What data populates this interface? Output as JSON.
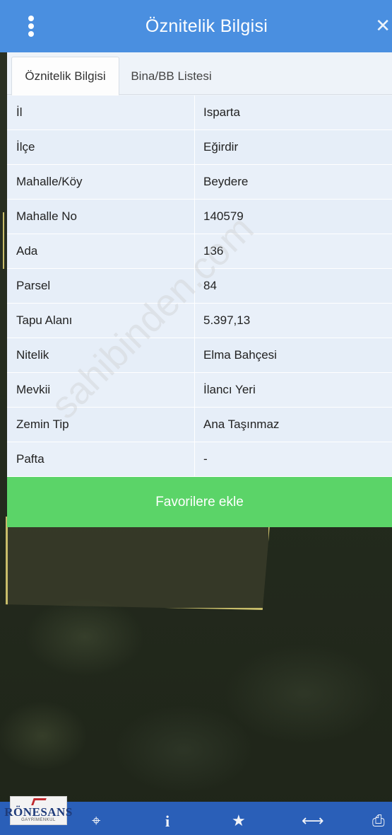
{
  "header": {
    "title": "Öznitelik Bilgisi",
    "menu_icon": "vertical-dots-icon",
    "close_label": "✕"
  },
  "tabs": [
    {
      "label": "Öznitelik Bilgisi",
      "active": true
    },
    {
      "label": "Bina/BB Listesi",
      "active": false
    }
  ],
  "attributes": [
    {
      "key": "İl",
      "value": "Isparta"
    },
    {
      "key": "İlçe",
      "value": "Eğirdir"
    },
    {
      "key": "Mahalle/Köy",
      "value": "Beydere"
    },
    {
      "key": "Mahalle No",
      "value": "140579"
    },
    {
      "key": "Ada",
      "value": "136"
    },
    {
      "key": "Parsel",
      "value": "84"
    },
    {
      "key": "Tapu Alanı",
      "value": "5.397,13"
    },
    {
      "key": "Nitelik",
      "value": "Elma Bahçesi"
    },
    {
      "key": "Mevkii",
      "value": "İlancı Yeri"
    },
    {
      "key": "Zemin Tip",
      "value": "Ana Taşınmaz"
    },
    {
      "key": "Pafta",
      "value": "-"
    }
  ],
  "favorite_button": {
    "label": "Favorilere ekle"
  },
  "watermark": "sahibinden.com",
  "logo": {
    "text": "RÖNESANS",
    "subtext": "GAYRİMENKUL"
  },
  "toolbar": {
    "icons": [
      "refresh-icon",
      "crosshair-icon",
      "info-icon",
      "star-icon",
      "horizontal-arrows-icon",
      "print-icon"
    ]
  },
  "colors": {
    "header": "#4a8fe0",
    "favorite_button": "#5bd468",
    "toolbar": "#2a5fb8"
  }
}
